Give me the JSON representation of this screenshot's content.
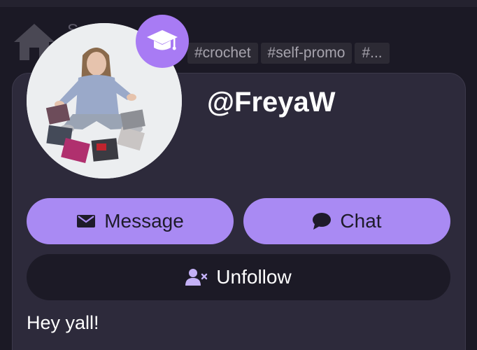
{
  "header": {
    "blurb_partial": "S",
    "tags": [
      "#crochet",
      "#self-promo",
      "#..."
    ]
  },
  "profile": {
    "username": "@FreyaW",
    "avatar_icon": "profile-photo",
    "badge_icon": "graduation-cap-icon",
    "bio": "Hey yall!"
  },
  "actions": {
    "message_label": "Message",
    "chat_label": "Chat",
    "unfollow_label": "Unfollow"
  },
  "colors": {
    "accent": "#a98af3",
    "badge": "#a87bf4",
    "card_bg": "#2d2a3b",
    "page_bg": "#1b1925"
  }
}
